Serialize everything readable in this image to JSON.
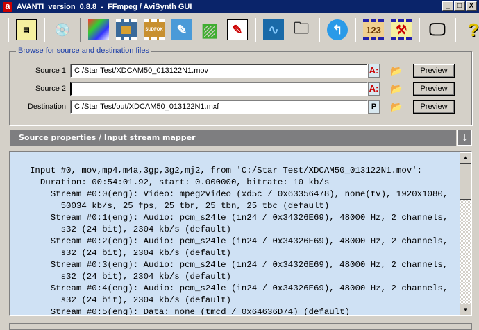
{
  "window": {
    "title": "AVANTI  version  0.8.8  -  FFmpeg / AviSynth GUI",
    "controls": [
      "_",
      "□",
      "X"
    ]
  },
  "toolbar": {
    "icons": [
      "app-window-icon",
      "open-disc-icon",
      "filters-icon",
      "video-film-icon",
      "sudfok-film-icon",
      "notes-icon",
      "ffmpeg-icon",
      "edit-icon",
      "audio-wave-icon",
      "folder-icon",
      "back-arrow-icon",
      "counter-icon",
      "tools-icon",
      "monitor-icon",
      "help-icon"
    ]
  },
  "browse": {
    "title": "Browse for source and destination files",
    "rows": [
      {
        "label": "Source 1",
        "value": "C:/Star Test/XDCAM50_013122N1.mov",
        "drive": "A:",
        "preview": "Preview"
      },
      {
        "label": "Source 2",
        "value": "",
        "drive": "A:",
        "preview": "Preview"
      },
      {
        "label": "Destination",
        "value": "C:/Star Test/out/XDCAM50_013122N1.mxf",
        "drive": "P",
        "preview": "Preview"
      }
    ]
  },
  "section": {
    "title": "Source properties / Input stream mapper"
  },
  "output": {
    "lines": [
      "Input #0, mov,mp4,m4a,3gp,3g2,mj2, from 'C:/Star Test/XDCAM50_013122N1.mov':",
      "  Duration: 00:54:01.92, start: 0.000000, bitrate: 10 kb/s",
      "    Stream #0:0(eng): Video: mpeg2video (xd5c / 0x63356478), none(tv), 1920x1080,",
      "      50034 kb/s, 25 fps, 25 tbr, 25 tbn, 25 tbc (default)",
      "    Stream #0:1(eng): Audio: pcm_s24le (in24 / 0x34326E69), 48000 Hz, 2 channels,",
      "      s32 (24 bit), 2304 kb/s (default)",
      "    Stream #0:2(eng): Audio: pcm_s24le (in24 / 0x34326E69), 48000 Hz, 2 channels,",
      "      s32 (24 bit), 2304 kb/s (default)",
      "    Stream #0:3(eng): Audio: pcm_s24le (in24 / 0x34326E69), 48000 Hz, 2 channels,",
      "      s32 (24 bit), 2304 kb/s (default)",
      "    Stream #0:4(eng): Audio: pcm_s24le (in24 / 0x34326E69), 48000 Hz, 2 channels,",
      "      s32 (24 bit), 2304 kb/s (default)",
      "    Stream #0:5(eng): Data: none (tmcd / 0x64636D74) (default)"
    ]
  }
}
